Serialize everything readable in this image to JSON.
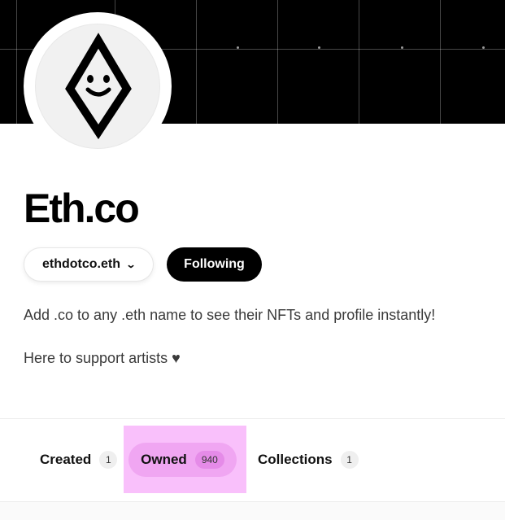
{
  "profile": {
    "name": "Eth.co",
    "ens_name": "ethdotco.eth",
    "follow_label": "Following",
    "bio": [
      "Add .co to any .eth name to see their NFTs and profile instantly!",
      "Here to support artists ♥"
    ]
  },
  "tabs": [
    {
      "label": "Created",
      "count": "1",
      "selected": false
    },
    {
      "label": "Owned",
      "count": "940",
      "selected": true
    },
    {
      "label": "Collections",
      "count": "1",
      "selected": false
    }
  ],
  "icons": {
    "avatar": "diamond-smiley-icon",
    "ens_dropdown": "chevron-down-icon"
  },
  "colors": {
    "banner": "#000000",
    "follow_button": "#000000",
    "selected_tab_highlight": "#f9c0fb",
    "selected_tab_pill": "#f0a6f2"
  }
}
